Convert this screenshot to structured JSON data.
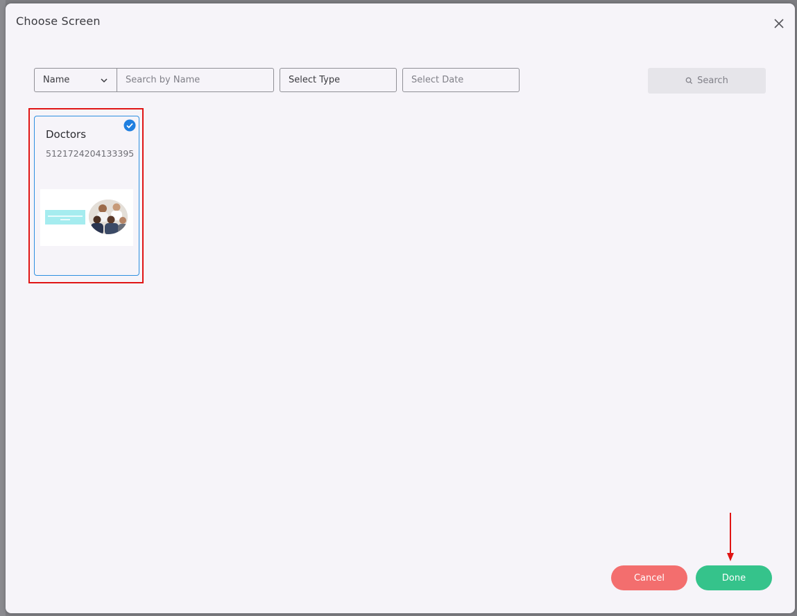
{
  "modal": {
    "title": "Choose Screen"
  },
  "filters": {
    "name_select": "Name",
    "name_input_placeholder": "Search by Name",
    "type_select": "Select Type",
    "date_placeholder": "Select Date",
    "search_label": "Search"
  },
  "screens": [
    {
      "name": "Doctors",
      "id": "5121724204133395",
      "selected": true
    }
  ],
  "footer": {
    "cancel_label": "Cancel",
    "done_label": "Done"
  },
  "colors": {
    "cancel": "#f36e6e",
    "done": "#35c38b",
    "selected_border": "#2c8fe0",
    "highlight": "#e01414"
  },
  "icons": {
    "close": "close-icon",
    "chevron": "chevron-down-icon",
    "search": "search-icon",
    "check": "check-circle-icon"
  }
}
